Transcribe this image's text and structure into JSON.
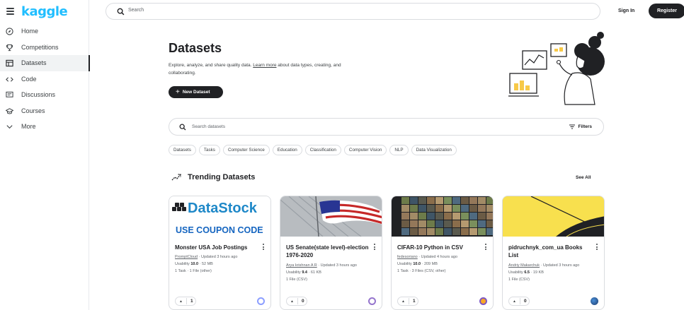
{
  "brand": {
    "logo": "kaggle",
    "accent": "#20beff"
  },
  "sidebar": {
    "items": [
      {
        "label": "Home",
        "icon": "compass-icon"
      },
      {
        "label": "Competitions",
        "icon": "trophy-icon"
      },
      {
        "label": "Datasets",
        "icon": "table-icon",
        "active": true
      },
      {
        "label": "Code",
        "icon": "code-icon"
      },
      {
        "label": "Discussions",
        "icon": "comment-icon"
      },
      {
        "label": "Courses",
        "icon": "graduation-cap-icon"
      },
      {
        "label": "More",
        "icon": "chevron-down-icon"
      }
    ]
  },
  "header": {
    "search_placeholder": "Search",
    "sign_in": "Sign In",
    "register": "Register"
  },
  "hero": {
    "title": "Datasets",
    "subtitle_before": "Explore, analyze, and share quality data. ",
    "subtitle_link": "Learn more",
    "subtitle_after": " about data types, creating, and collaborating.",
    "new_dataset": "New Dataset"
  },
  "search": {
    "placeholder": "Search datasets",
    "filters": "Filters"
  },
  "chips": [
    "Datasets",
    "Tasks",
    "Computer Science",
    "Education",
    "Classification",
    "Computer Vision",
    "NLP",
    "Data Visualization"
  ],
  "trending": {
    "title": "Trending Datasets",
    "see_all": "See All"
  },
  "cards": [
    {
      "name": "Monster USA Job Postings",
      "author": "PromptCloud",
      "updated": "Updated 3 hours ago",
      "usability_label": "Usability",
      "usability": "10.0",
      "size": "52 MB",
      "files": "1 Task · 1 File (other)",
      "votes": "1",
      "thumb_text_1": "DataStock",
      "thumb_text_2": "USE COUPON CODE"
    },
    {
      "name": "US Senate(state level)-election 1976-2020",
      "author": "Arya krishnan A R",
      "updated": "Updated 3 hours ago",
      "usability_label": "Usability",
      "usability": "9.4",
      "size": "61 KB",
      "files": "1 File (CSV)",
      "votes": "0"
    },
    {
      "name": "CIFAR-10 Python in CSV",
      "author": "fedesoriano",
      "updated": "Updated 4 hours ago",
      "usability_label": "Usability",
      "usability": "10.0",
      "size": "209 MB",
      "files": "1 Task · 3 Files (CSV, other)",
      "votes": "1"
    },
    {
      "name": "pidruchnyk_com_ua Books List",
      "author": "Andriy Makarchuk",
      "updated": "Updated 3 hours ago",
      "usability_label": "Usability",
      "usability": "6.5",
      "size": "19 KB",
      "files": "1 File (CSV)",
      "votes": "0"
    }
  ]
}
